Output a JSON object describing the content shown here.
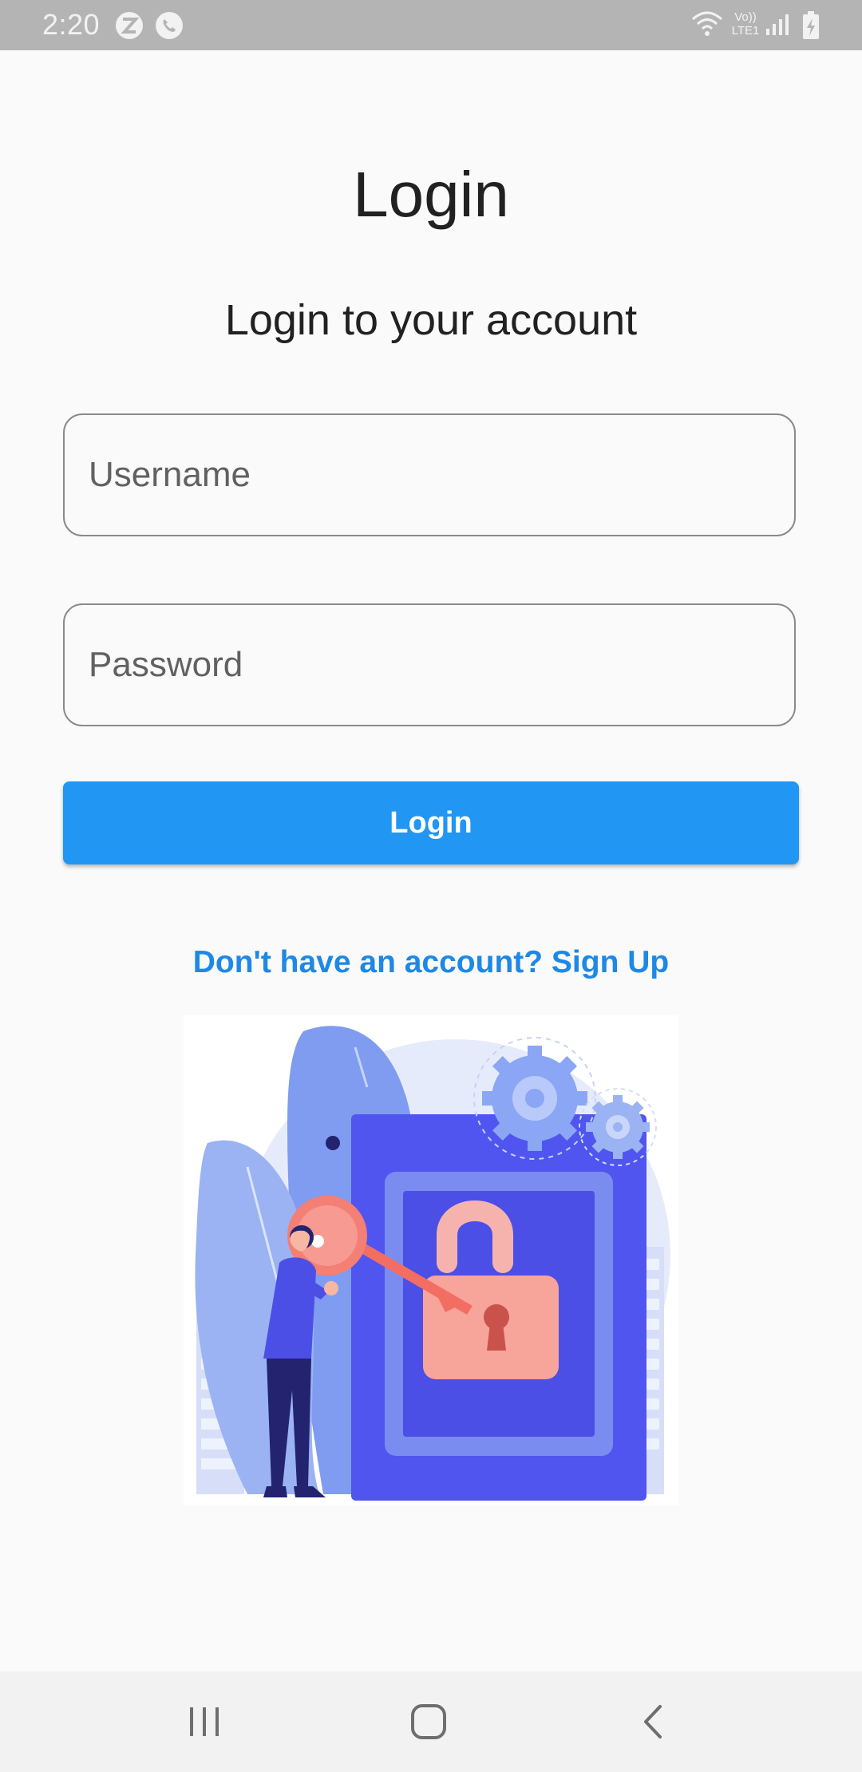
{
  "status_bar": {
    "time": "2:20",
    "left_icons": [
      "z-app-icon",
      "phone-call-icon"
    ],
    "right_icons": [
      "wifi-icon",
      "volte-icon",
      "signal-icon",
      "battery-charging-icon"
    ],
    "volte_text_top": "Vo))",
    "volte_text_bottom": "LTE1"
  },
  "screen": {
    "title": "Login",
    "subtitle": "Login to your account"
  },
  "form": {
    "username": {
      "placeholder": "Username",
      "value": ""
    },
    "password": {
      "placeholder": "Password",
      "value": ""
    },
    "login_label": "Login",
    "signup_text": "Don't have an account? Sign Up"
  },
  "illustration": {
    "icon": "unlock-illustration",
    "subject": "person with key unlocking padlock"
  },
  "nav_bar": {
    "icons": [
      "recent-apps-icon",
      "home-icon",
      "back-icon"
    ]
  },
  "colors": {
    "primary": "#2196f3",
    "link": "#1e88e5",
    "illustration_blue": "#5055f0",
    "illustration_salmon": "#f4897f"
  }
}
